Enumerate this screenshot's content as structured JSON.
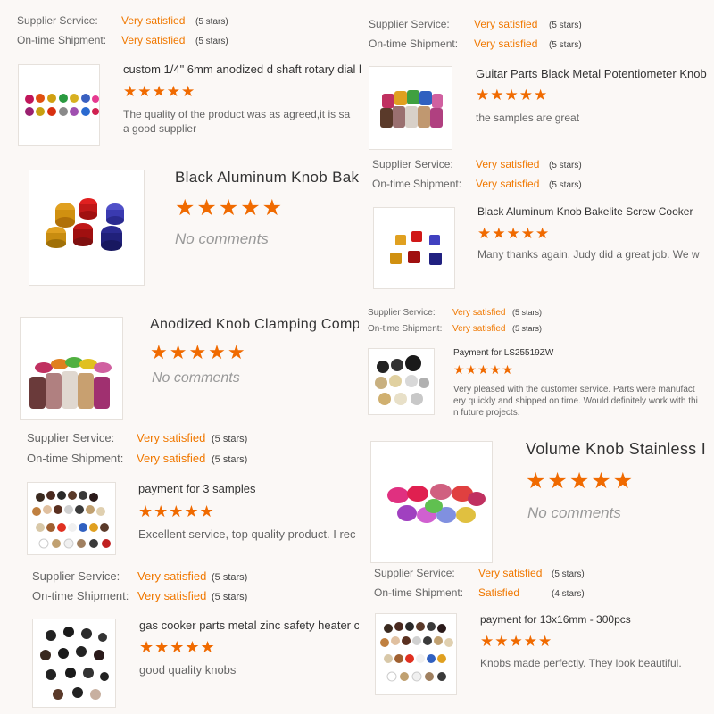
{
  "colors": {
    "accent": "#f07800",
    "star": "#f06a00",
    "label": "#666666",
    "background": "#fbf8f6"
  },
  "icons": {
    "star": "star-icon"
  },
  "star_glyphs": "★★★★★",
  "card1": {
    "supplier_label": "Supplier Service:",
    "supplier_value": "Very satisfied",
    "supplier_stars": "(5 stars)",
    "shipment_label": "On-time Shipment:",
    "shipment_value": "Very satisfied",
    "shipment_stars": "(5 stars)",
    "title": "custom 1/4\" 6mm anodized d shaft rotary dial k",
    "rating": 5,
    "comment_line1": "The quality of the product was as agreed,it is sa",
    "comment_line2": "a good supplier"
  },
  "card2": {
    "supplier_label": "Supplier Service:",
    "supplier_value": "Very satisfied",
    "supplier_stars": "(5 stars)",
    "shipment_label": "On-time Shipment:",
    "shipment_value": "Very satisfied",
    "shipment_stars": "(5 stars)",
    "title": "Guitar Parts Black Metal Potentiometer Knob",
    "rating": 5,
    "comment": "the samples are great"
  },
  "card3": {
    "title": "Black Aluminum Knob Bak",
    "rating": 5,
    "comment": "No comments"
  },
  "card4": {
    "supplier_label": "Supplier Service:",
    "supplier_value": "Very satisfied",
    "supplier_stars": "(5 stars)",
    "shipment_label": "On-time Shipment:",
    "shipment_value": "Very satisfied",
    "shipment_stars": "(5 stars)",
    "title": "Black Aluminum Knob Bakelite Screw Cooker",
    "rating": 5,
    "comment": "Many thanks again. Judy did a great job. We w"
  },
  "card5": {
    "title": "Anodized Knob Clamping Comput",
    "rating": 5,
    "comment": "No comments"
  },
  "card6": {
    "supplier_label": "Supplier Service:",
    "supplier_value": "Very satisfied",
    "supplier_stars": "(5 stars)",
    "shipment_label": "On-time Shipment:",
    "shipment_value": "Very satisfied",
    "shipment_stars": "(5 stars)",
    "title": "Payment for LS25519ZW",
    "rating": 5,
    "comment_line1": "Very pleased with the customer service. Parts were manufact",
    "comment_line2": "ery quickly and shipped on time. Would definitely work with thi",
    "comment_line3": "n future projects."
  },
  "card7": {
    "supplier_label": "Supplier Service:",
    "supplier_value": "Very satisfied",
    "supplier_stars": "(5 stars)",
    "shipment_label": "On-time Shipment:",
    "shipment_value": "Very satisfied",
    "shipment_stars": "(5 stars)",
    "title": "payment for 3 samples",
    "rating": 5,
    "comment": "Excellent service, top quality product. I rec"
  },
  "card8": {
    "title": "Volume Knob Stainless I",
    "rating": 5,
    "comment": "No comments"
  },
  "card9": {
    "supplier_label": "Supplier Service:",
    "supplier_value": "Very satisfied",
    "supplier_stars": "(5 stars)",
    "shipment_label": "On-time Shipment:",
    "shipment_value": "Very satisfied",
    "shipment_stars": "(5 stars)",
    "title": "gas cooker parts metal zinc safety heater c",
    "rating": 5,
    "comment": "good quality knobs"
  },
  "card10": {
    "supplier_label": "Supplier Service:",
    "supplier_value": "Very satisfied",
    "supplier_stars": "(5 stars)",
    "shipment_label": "On-time Shipment:",
    "shipment_value": "Satisfied",
    "shipment_stars": "(4 stars)",
    "title": "payment for 13x16mm - 300pcs",
    "rating": 5,
    "comment": "Knobs made perfectly. They look beautiful."
  }
}
